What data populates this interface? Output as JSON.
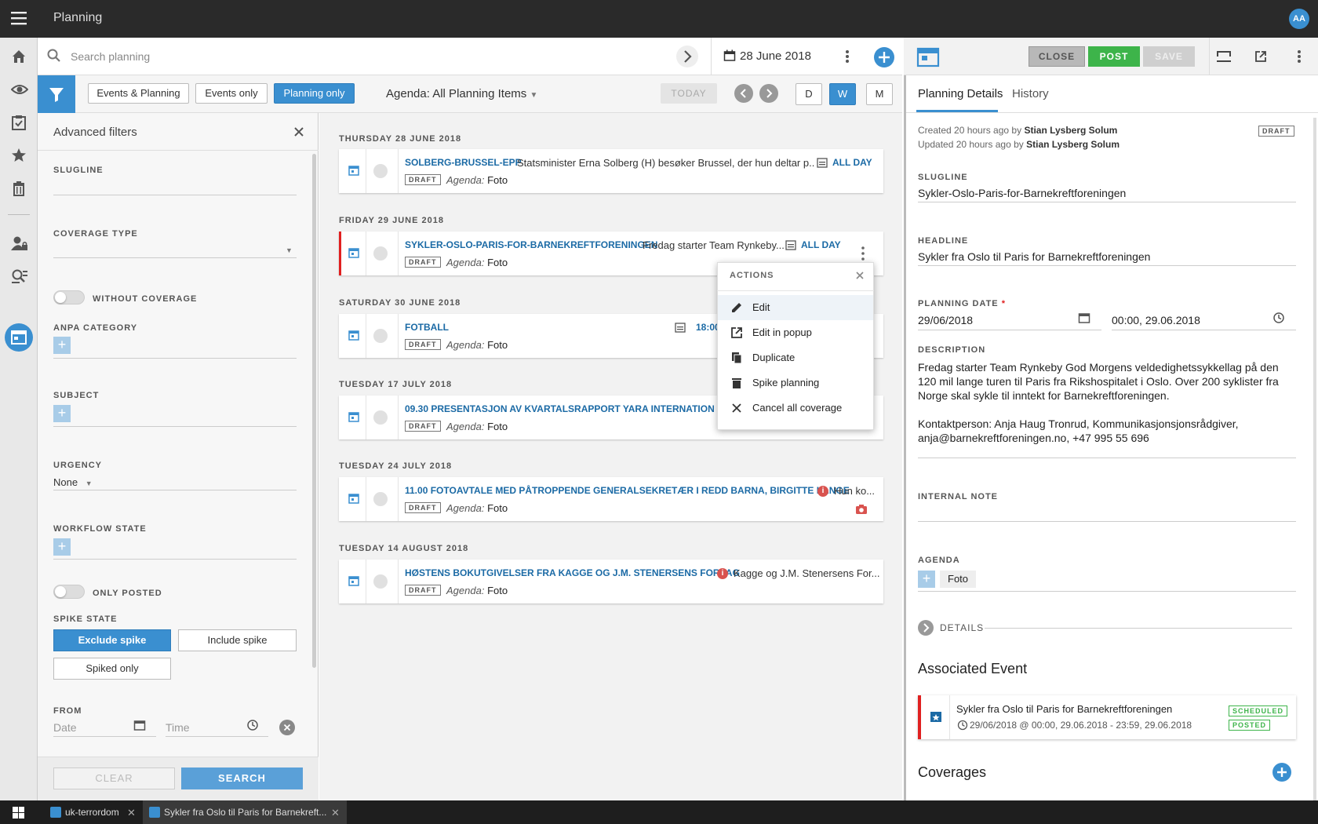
{
  "app": {
    "title": "Planning",
    "user_initials": "AA"
  },
  "toolbar": {
    "search_placeholder": "Search planning",
    "current_date": "28 June 2018"
  },
  "filters": {
    "tabs": [
      "Events & Planning",
      "Events only",
      "Planning only"
    ],
    "active_tab": "Planning only",
    "agenda_label": "Agenda: All Planning Items",
    "today_label": "TODAY",
    "views": [
      "D",
      "W",
      "M"
    ],
    "active_view": "W"
  },
  "advanced_filters": {
    "title": "Advanced filters",
    "slugline_label": "SLUGLINE",
    "coverage_type_label": "COVERAGE TYPE",
    "without_coverage_label": "WITHOUT COVERAGE",
    "anpa_category_label": "ANPA CATEGORY",
    "subject_label": "SUBJECT",
    "urgency_label": "URGENCY",
    "urgency_value": "None",
    "workflow_state_label": "WORKFLOW STATE",
    "only_posted_label": "ONLY POSTED",
    "spike_state_label": "SPIKE STATE",
    "spike_options": [
      "Exclude spike",
      "Include spike",
      "Spiked only"
    ],
    "active_spike": "Exclude spike",
    "from_label": "FROM",
    "date_placeholder": "Date",
    "time_placeholder": "Time",
    "clear_label": "CLEAR",
    "search_label": "SEARCH"
  },
  "list": {
    "groups": [
      {
        "day": "THURSDAY 28 JUNE 2018",
        "items": [
          {
            "slug": "SOLBERG-BRUSSEL-EPP",
            "desc": "Statsminister Erna Solberg (H) besøker Brussel, der hun deltar p...",
            "time": "ALL DAY",
            "status": "DRAFT",
            "agenda_label": "Agenda:",
            "agenda": "Foto"
          }
        ]
      },
      {
        "day": "FRIDAY 29 JUNE 2018",
        "items": [
          {
            "slug": "SYKLER-OSLO-PARIS-FOR-BARNEKREFTFORENINGEN",
            "desc": "Fredag starter Team Rynkeby...",
            "time": "ALL DAY",
            "status": "DRAFT",
            "agenda_label": "Agenda:",
            "agenda": "Foto"
          }
        ]
      },
      {
        "day": "SATURDAY 30 JUNE 2018",
        "items": [
          {
            "slug": "FOTBALL",
            "desc": "",
            "time": "18:00",
            "status": "DRAFT",
            "agenda_label": "Agenda:",
            "agenda": "Foto"
          }
        ]
      },
      {
        "day": "TUESDAY 17 JULY 2018",
        "items": [
          {
            "slug": "09.30 PRESENTASJON AV KVARTALSRAPPORT YARA INTERNATIONAL A",
            "desc": "",
            "time": "",
            "status": "DRAFT",
            "agenda_label": "Agenda:",
            "agenda": "Foto"
          }
        ]
      },
      {
        "day": "TUESDAY 24 JULY 2018",
        "items": [
          {
            "slug": "11.00 FOTOAVTALE MED PÅTROPPENDE GENERALSEKRETÆR I REDD BARNA, BIRGITTE LANGE",
            "desc": "Hun ko...",
            "time": "",
            "status": "DRAFT",
            "agenda_label": "Agenda:",
            "agenda": "Foto"
          }
        ]
      },
      {
        "day": "TUESDAY 14 AUGUST 2018",
        "items": [
          {
            "slug": "HØSTENS BOKUTGIVELSER FRA KAGGE OG J.M. STENERSENS FORLAG",
            "desc": "Kagge og J.M. Stenersens For...",
            "time": "",
            "status": "DRAFT",
            "agenda_label": "Agenda:",
            "agenda": "Foto"
          }
        ]
      }
    ]
  },
  "actions_menu": {
    "title": "ACTIONS",
    "items": [
      "Edit",
      "Edit in popup",
      "Duplicate",
      "Spike planning",
      "Cancel all coverage"
    ]
  },
  "panel": {
    "close_label": "CLOSE",
    "post_label": "POST",
    "save_label": "SAVE",
    "tab_details": "Planning Details",
    "tab_history": "History",
    "created": "Created 20 hours ago by",
    "updated": "Updated 20 hours ago by",
    "author": "Stian Lysberg Solum",
    "status": "DRAFT",
    "slugline_label": "SLUGLINE",
    "slugline": "Sykler-Oslo-Paris-for-Barnekreftforeningen",
    "headline_label": "HEADLINE",
    "headline": "Sykler fra Oslo til Paris for Barnekreftforeningen",
    "planning_date_label": "PLANNING DATE",
    "required_mark": "*",
    "planning_date": "29/06/2018",
    "planning_time": "00:00, 29.06.2018",
    "description_label": "DESCRIPTION",
    "description": "Fredag starter Team Rynkeby God Morgens veldedighetssykkellag på den 120 mil lange turen til Paris fra Rikshospitalet i Oslo. Over 200 syklister fra Norge skal sykle til inntekt for Barnekreftforeningen.\n\nKontaktperson: Anja Haug Tronrud, Kommunikasjonsjonsrådgiver, anja@barnekreftforeningen.no, +47 995 55 696",
    "internal_note_label": "INTERNAL NOTE",
    "agenda_label": "AGENDA",
    "agenda": "Foto",
    "details_label": "DETAILS",
    "associated_event_label": "Associated Event",
    "event_title": "Sykler fra Oslo til Paris for Barnekreftforeningen",
    "event_time": "29/06/2018 @ 00:00, 29.06.2018 - 23:59, 29.06.2018",
    "event_badges": [
      "SCHEDULED",
      "POSTED"
    ],
    "coverages_label": "Coverages"
  },
  "taskbar": {
    "tabs": [
      "uk-terrordom",
      "Sykler fra Oslo til Paris for Barnekreft..."
    ]
  }
}
